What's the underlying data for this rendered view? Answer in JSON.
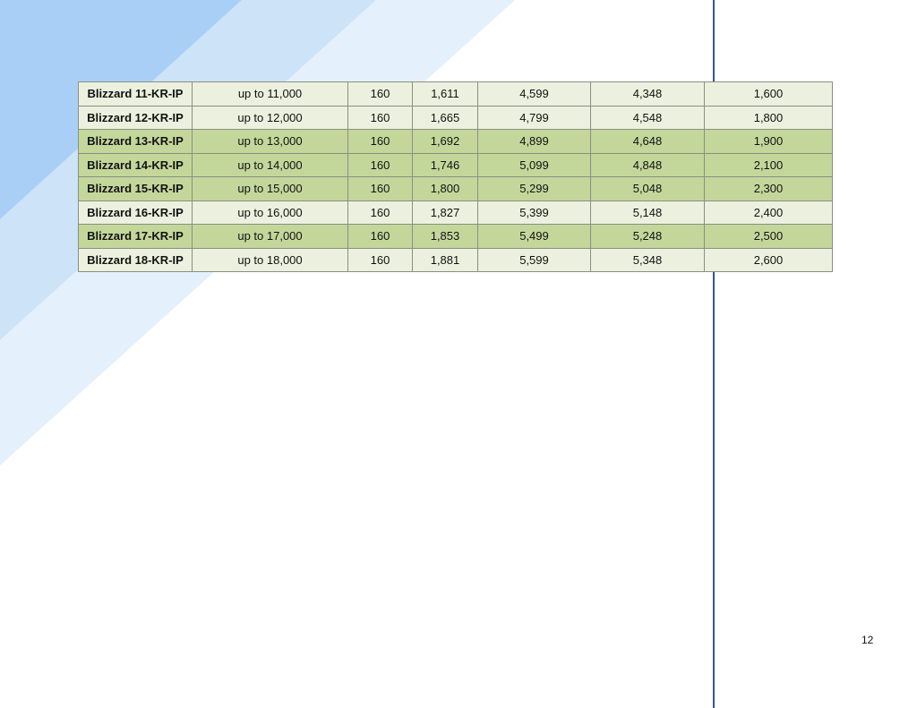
{
  "table": {
    "rows": [
      {
        "model": "Blizzard 11-KR-IP",
        "capacity": "up to 11,000",
        "c3": "160",
        "c4": "1,611",
        "c5": "4,599",
        "c6": "4,348",
        "c7": "1,600",
        "shade": "light"
      },
      {
        "model": "Blizzard 12-KR-IP",
        "capacity": "up to 12,000",
        "c3": "160",
        "c4": "1,665",
        "c5": "4,799",
        "c6": "4,548",
        "c7": "1,800",
        "shade": "light"
      },
      {
        "model": "Blizzard 13-KR-IP",
        "capacity": "up to 13,000",
        "c3": "160",
        "c4": "1,692",
        "c5": "4,899",
        "c6": "4,648",
        "c7": "1,900",
        "shade": "dark"
      },
      {
        "model": "Blizzard 14-KR-IP",
        "capacity": "up to 14,000",
        "c3": "160",
        "c4": "1,746",
        "c5": "5,099",
        "c6": "4,848",
        "c7": "2,100",
        "shade": "dark"
      },
      {
        "model": "Blizzard 15-KR-IP",
        "capacity": "up to 15,000",
        "c3": "160",
        "c4": "1,800",
        "c5": "5,299",
        "c6": "5,048",
        "c7": "2,300",
        "shade": "dark"
      },
      {
        "model": "Blizzard 16-KR-IP",
        "capacity": "up to 16,000",
        "c3": "160",
        "c4": "1,827",
        "c5": "5,399",
        "c6": "5,148",
        "c7": "2,400",
        "shade": "light"
      },
      {
        "model": "Blizzard 17-KR-IP",
        "capacity": "up to 17,000",
        "c3": "160",
        "c4": "1,853",
        "c5": "5,499",
        "c6": "5,248",
        "c7": "2,500",
        "shade": "dark"
      },
      {
        "model": "Blizzard 18-KR-IP",
        "capacity": "up to 18,000",
        "c3": "160",
        "c4": "1,881",
        "c5": "5,599",
        "c6": "5,348",
        "c7": "2,600",
        "shade": "light"
      }
    ]
  },
  "footer": {
    "page_number": "12"
  },
  "colors": {
    "row_light": "#ebf1de",
    "row_dark": "#c4d79b",
    "vertical_rule": "#3b4f9a",
    "stripe_light": "#e4f0fb",
    "stripe_mid": "#cde3f7",
    "stripe_dark": "#a9cff6"
  }
}
